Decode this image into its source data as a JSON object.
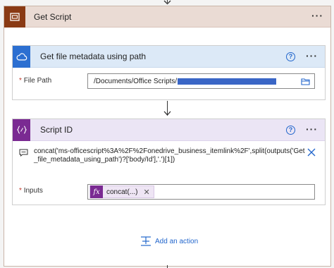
{
  "scope": {
    "title": "Get Script",
    "more": "···",
    "icon": "scope-icon"
  },
  "metadata_card": {
    "title": "Get file metadata using path",
    "icon": "onedrive-cloud-icon",
    "help": "?",
    "more": "···",
    "file_path_label": "File Path",
    "file_path_required": "*",
    "file_path_value": "/Documents/Office Scripts/",
    "folder_icon": "folder-icon",
    "accent": "#3366cc"
  },
  "script_card": {
    "title": "Script ID",
    "icon": "data-operation-icon",
    "help": "?",
    "more": "···",
    "expression": "concat('ms-officescript%3A%2F%2Fonedrive_business_itemlink%2F',split(outputs('Get_file_metadata_using_path')?['body/Id'],'.')[1])",
    "inputs_label": "Inputs",
    "inputs_required": "*",
    "token_label": "concat(...)",
    "token_remove": "✕",
    "accent": "#7a2a92"
  },
  "add_action": {
    "label": "Add an action",
    "icon": "add-action-icon"
  }
}
